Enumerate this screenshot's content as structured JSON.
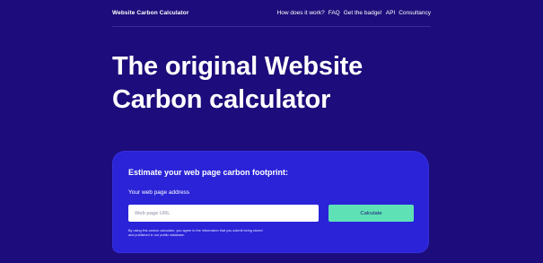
{
  "colors": {
    "page_background": "#1d0c7b",
    "card_background": "#2a23d8",
    "button_accent": "#5ee2b5",
    "text": "#ffffff"
  },
  "header": {
    "brand": "Website Carbon Calculator",
    "nav": [
      {
        "label": "How does it work?"
      },
      {
        "label": "FAQ"
      },
      {
        "label": "Get the badge!"
      },
      {
        "label": "API"
      },
      {
        "label": "Consultancy"
      }
    ]
  },
  "hero": {
    "title_line_1": "The original Website",
    "title_line_2": "Carbon calculator"
  },
  "calculator": {
    "title": "Estimate your web page carbon footprint:",
    "field_label": "Your web page address",
    "url_input": {
      "value": "",
      "placeholder": "Web page URL"
    },
    "button_label": "Calculate",
    "disclaimer": "By using this carbon calculator, you agree to the information that you submit being stored and published in our public database."
  }
}
